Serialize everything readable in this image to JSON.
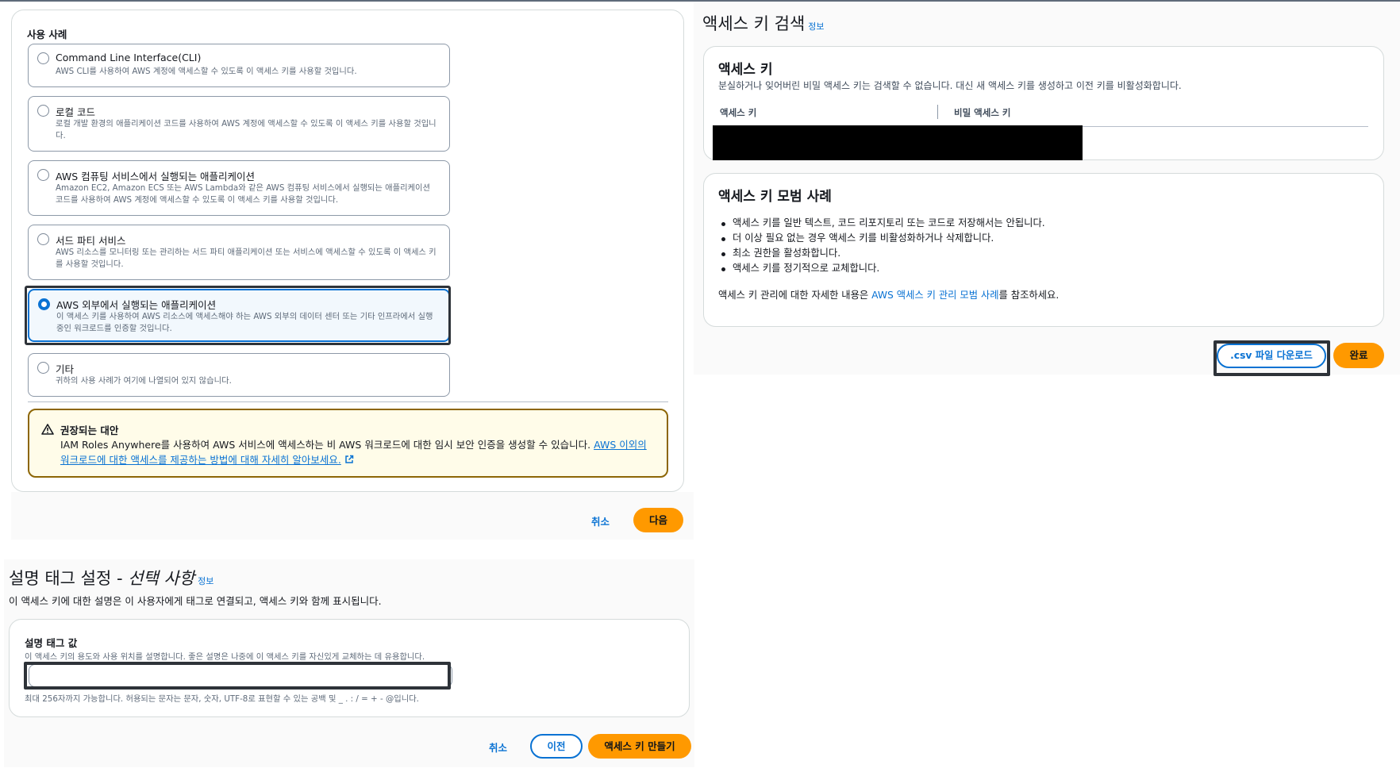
{
  "use_case": {
    "section_label": "사용 사례",
    "options": [
      {
        "title": "Command Line Interface(CLI)",
        "desc": "AWS CLI를 사용하여 AWS 계정에 액세스할 수 있도록 이 액세스 키를 사용할 것입니다.",
        "selected": false
      },
      {
        "title": "로컬 코드",
        "desc": "로컬 개발 환경의 애플리케이션 코드를 사용하여 AWS 계정에 액세스할 수 있도록 이 액세스 키를 사용할 것입니다.",
        "selected": false
      },
      {
        "title": "AWS 컴퓨팅 서비스에서 실행되는 애플리케이션",
        "desc": "Amazon EC2, Amazon ECS 또는 AWS Lambda와 같은 AWS 컴퓨팅 서비스에서 실행되는 애플리케이션 코드를 사용하여 AWS 계정에 액세스할 수 있도록 이 액세스 키를 사용할 것입니다.",
        "selected": false
      },
      {
        "title": "서드 파티 서비스",
        "desc": "AWS 리소스를 모니터링 또는 관리하는 서드 파티 애플리케이션 또는 서비스에 액세스할 수 있도록 이 액세스 키를 사용할 것입니다.",
        "selected": false
      },
      {
        "title": "AWS 외부에서 실행되는 애플리케이션",
        "desc": "이 액세스 키를 사용하여 AWS 리소스에 액세스해야 하는 AWS 외부의 데이터 센터 또는 기타 인프라에서 실행 중인 워크로드를 인증할 것입니다.",
        "selected": true
      },
      {
        "title": "기타",
        "desc": "귀하의 사용 사례가 여기에 나열되어 있지 않습니다.",
        "selected": false
      }
    ],
    "alert": {
      "title": "권장되는 대안",
      "body": "IAM Roles Anywhere를 사용하여 AWS 서비스에 액세스하는 비 AWS 워크로드에 대한 임시 보안 인증을 생성할 수 있습니다.",
      "link": "AWS 이외의 워크로드에 대한 액세스를 제공하는 방법에 대해 자세히 알아보세요."
    },
    "cancel": "취소",
    "next": "다음"
  },
  "description_tag": {
    "heading": "설명 태그 설정 - ",
    "heading_italic": "선택 사항",
    "info": "정보",
    "subtitle": "이 액세스 키에 대한 설명은 이 사용자에게 태그로 연결되고, 액세스 키와 함께 표시됩니다.",
    "field_label": "설명 태그 값",
    "field_help": "이 액세스 키의 용도와 사용 위치를 설명합니다. 좋은 설명은 나중에 이 액세스 키를 자신있게 교체하는 데 유용합니다.",
    "field_value": "",
    "field_constraint": "최대 256자까지 가능합니다. 허용되는 문자는 문자, 숫자, UTF-8로 표현할 수 있는 공백 및 _ . : / = + - @입니다.",
    "cancel": "취소",
    "previous": "이전",
    "create": "액세스 키 만들기"
  },
  "retrieve": {
    "heading": "액세스 키 검색",
    "info": "정보",
    "keys_title": "액세스 키",
    "keys_subtitle": "분실하거나 잊어버린 비밀 액세스 키는 검색할 수 없습니다. 대신 새 액세스 키를 생성하고 이전 키를 비활성화합니다.",
    "col_access_key": "액세스 키",
    "col_secret_key": "비밀 액세스 키",
    "best_title": "액세스 키 모범 사례",
    "best_items": [
      "액세스 키를 일반 텍스트, 코드 리포지토리 또는 코드로 저장해서는 안됩니다.",
      "더 이상 필요 없는 경우 액세스 키를 비활성화하거나 삭제합니다.",
      "최소 권한을 활성화합니다.",
      "액세스 키를 정기적으로 교체합니다."
    ],
    "best_note_prefix": "액세스 키 관리에 대한 자세한 내용은 ",
    "best_note_link": "AWS 액세스 키 관리 모범 사례",
    "best_note_suffix": "를 참조하세요.",
    "download_csv": ".csv 파일 다운로드",
    "done": "완료"
  },
  "colors": {
    "primary": "#ff9900",
    "link": "#0972d3",
    "selected_bg": "#f2f8fd",
    "alert_border": "#8d6605",
    "alert_bg": "#fffce9"
  }
}
